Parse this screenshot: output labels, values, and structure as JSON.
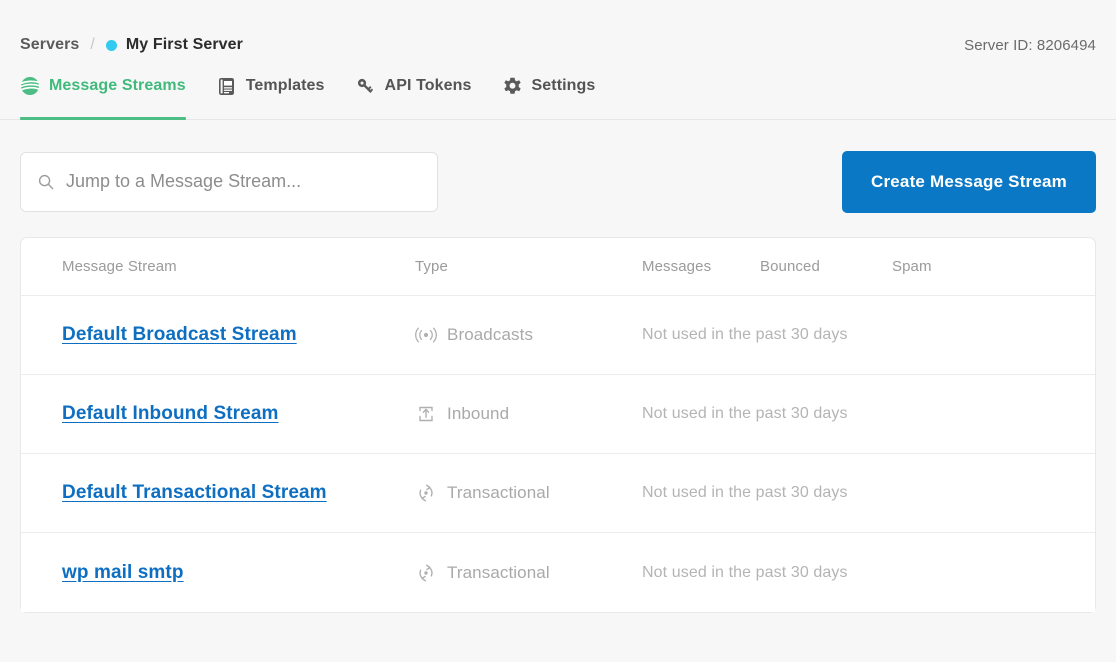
{
  "breadcrumb": {
    "root_label": "Servers",
    "separator": "/",
    "current_label": "My First Server",
    "status_color": "#33c9f0"
  },
  "header": {
    "server_id_text": "Server ID: 8206494"
  },
  "tabs": [
    {
      "label": "Message Streams",
      "icon": "message-streams-icon",
      "active": true
    },
    {
      "label": "Templates",
      "icon": "templates-icon",
      "active": false
    },
    {
      "label": "API Tokens",
      "icon": "key-icon",
      "active": false
    },
    {
      "label": "Settings",
      "icon": "gear-icon",
      "active": false
    }
  ],
  "toolbar": {
    "search_placeholder": "Jump to a Message Stream...",
    "search_value": "",
    "search_icon": "search-icon",
    "create_button_label": "Create Message Stream",
    "create_button_color": "#0a78c4"
  },
  "table": {
    "columns": [
      "Message Stream",
      "Type",
      "Messages",
      "Bounced",
      "Spam"
    ],
    "rows": [
      {
        "name": "Default Broadcast Stream",
        "type_label": "Broadcasts",
        "type_icon": "broadcast-icon",
        "note": "Not used in the past 30 days"
      },
      {
        "name": "Default Inbound Stream",
        "type_label": "Inbound",
        "type_icon": "inbound-tray-icon",
        "note": "Not used in the past 30 days"
      },
      {
        "name": "Default Transactional Stream",
        "type_label": "Transactional",
        "type_icon": "transactional-cycle-icon",
        "note": "Not used in the past 30 days"
      },
      {
        "name": "wp mail smtp",
        "type_label": "Transactional",
        "type_icon": "transactional-cycle-icon",
        "note": "Not used in the past 30 days"
      }
    ]
  },
  "colors": {
    "accent_green": "#4cbd84",
    "link_blue": "#0e6fc2",
    "page_bg": "#f7f7f7"
  }
}
